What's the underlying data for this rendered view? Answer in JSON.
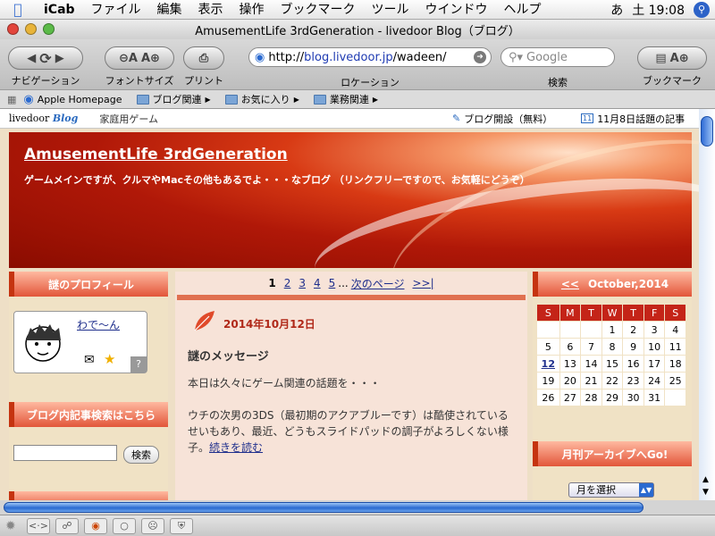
{
  "menubar": {
    "app": "iCab",
    "items": [
      "ファイル",
      "編集",
      "表示",
      "操作",
      "ブックマーク",
      "ツール",
      "ウインドウ",
      "ヘルプ"
    ],
    "clock": "土 19:08",
    "ime": "あ"
  },
  "window": {
    "title": "AmusementLife 3rdGeneration - livedoor Blog（ブログ）"
  },
  "toolbar": {
    "nav_label": "ナビゲーション",
    "font_label": "フォントサイズ",
    "print_label": "プリント",
    "location_label": "ロケーション",
    "search_label": "検索",
    "bookmark_label": "ブックマーク",
    "url_scheme": "http://",
    "url_host": "blog.livedoor.jp",
    "url_path": "/wadeen/",
    "search_placeholder": "Google"
  },
  "bookmarks": {
    "items": [
      "Apple Homepage",
      "ブログ関連",
      "お気に入り",
      "業務関連"
    ]
  },
  "livedoor_bar": {
    "logo_text": "livedoor",
    "logo_blog": "Blog",
    "category": "家庭用ゲーム",
    "link1": "ブログ開設（無料）",
    "link2": "11月8日話題の記事",
    "cal_num": "11"
  },
  "blog": {
    "title": "AmusementLife 3rdGeneration",
    "tagline": "ゲームメインですが、クルマやMacその他もあるでよ・・・なブログ （リンクフリーですので、お気軽にどうぞ）"
  },
  "left": {
    "profile_head": "謎のプロフィール",
    "profile_name": "わで〜ん",
    "profile_help": "?",
    "search_head": "ブログ内記事検索はこちら",
    "search_button": "検索"
  },
  "main": {
    "pages": [
      "1",
      "2",
      "3",
      "4",
      "5"
    ],
    "ellipsis": "...",
    "next": "次のページ",
    "last": ">>|",
    "date": "2014年10月12日",
    "title": "謎のメッセージ",
    "para1": "本日は久々にゲーム関連の話題を・・・",
    "para2": "ウチの次男の3DS（最初期のアクアブルーです）は酷使されているせいもあり、最近、どうもスライドパッドの調子がよろしくない様子。",
    "more": "続きを読む"
  },
  "right": {
    "cal_prev": "<<",
    "cal_month": "October,2014",
    "weekdays": [
      "S",
      "M",
      "T",
      "W",
      "T",
      "F",
      "S"
    ],
    "weeks": [
      [
        "",
        "",
        "",
        "1",
        "2",
        "3",
        "4"
      ],
      [
        "5",
        "6",
        "7",
        "8",
        "9",
        "10",
        "11"
      ],
      [
        "12",
        "13",
        "14",
        "15",
        "16",
        "17",
        "18"
      ],
      [
        "19",
        "20",
        "21",
        "22",
        "23",
        "24",
        "25"
      ],
      [
        "26",
        "27",
        "28",
        "29",
        "30",
        "31",
        ""
      ]
    ],
    "today": "12",
    "archive_head": "月刊アーカイブへGo!",
    "archive_select": "月を選択"
  },
  "status": {
    "progress": 0.9
  }
}
